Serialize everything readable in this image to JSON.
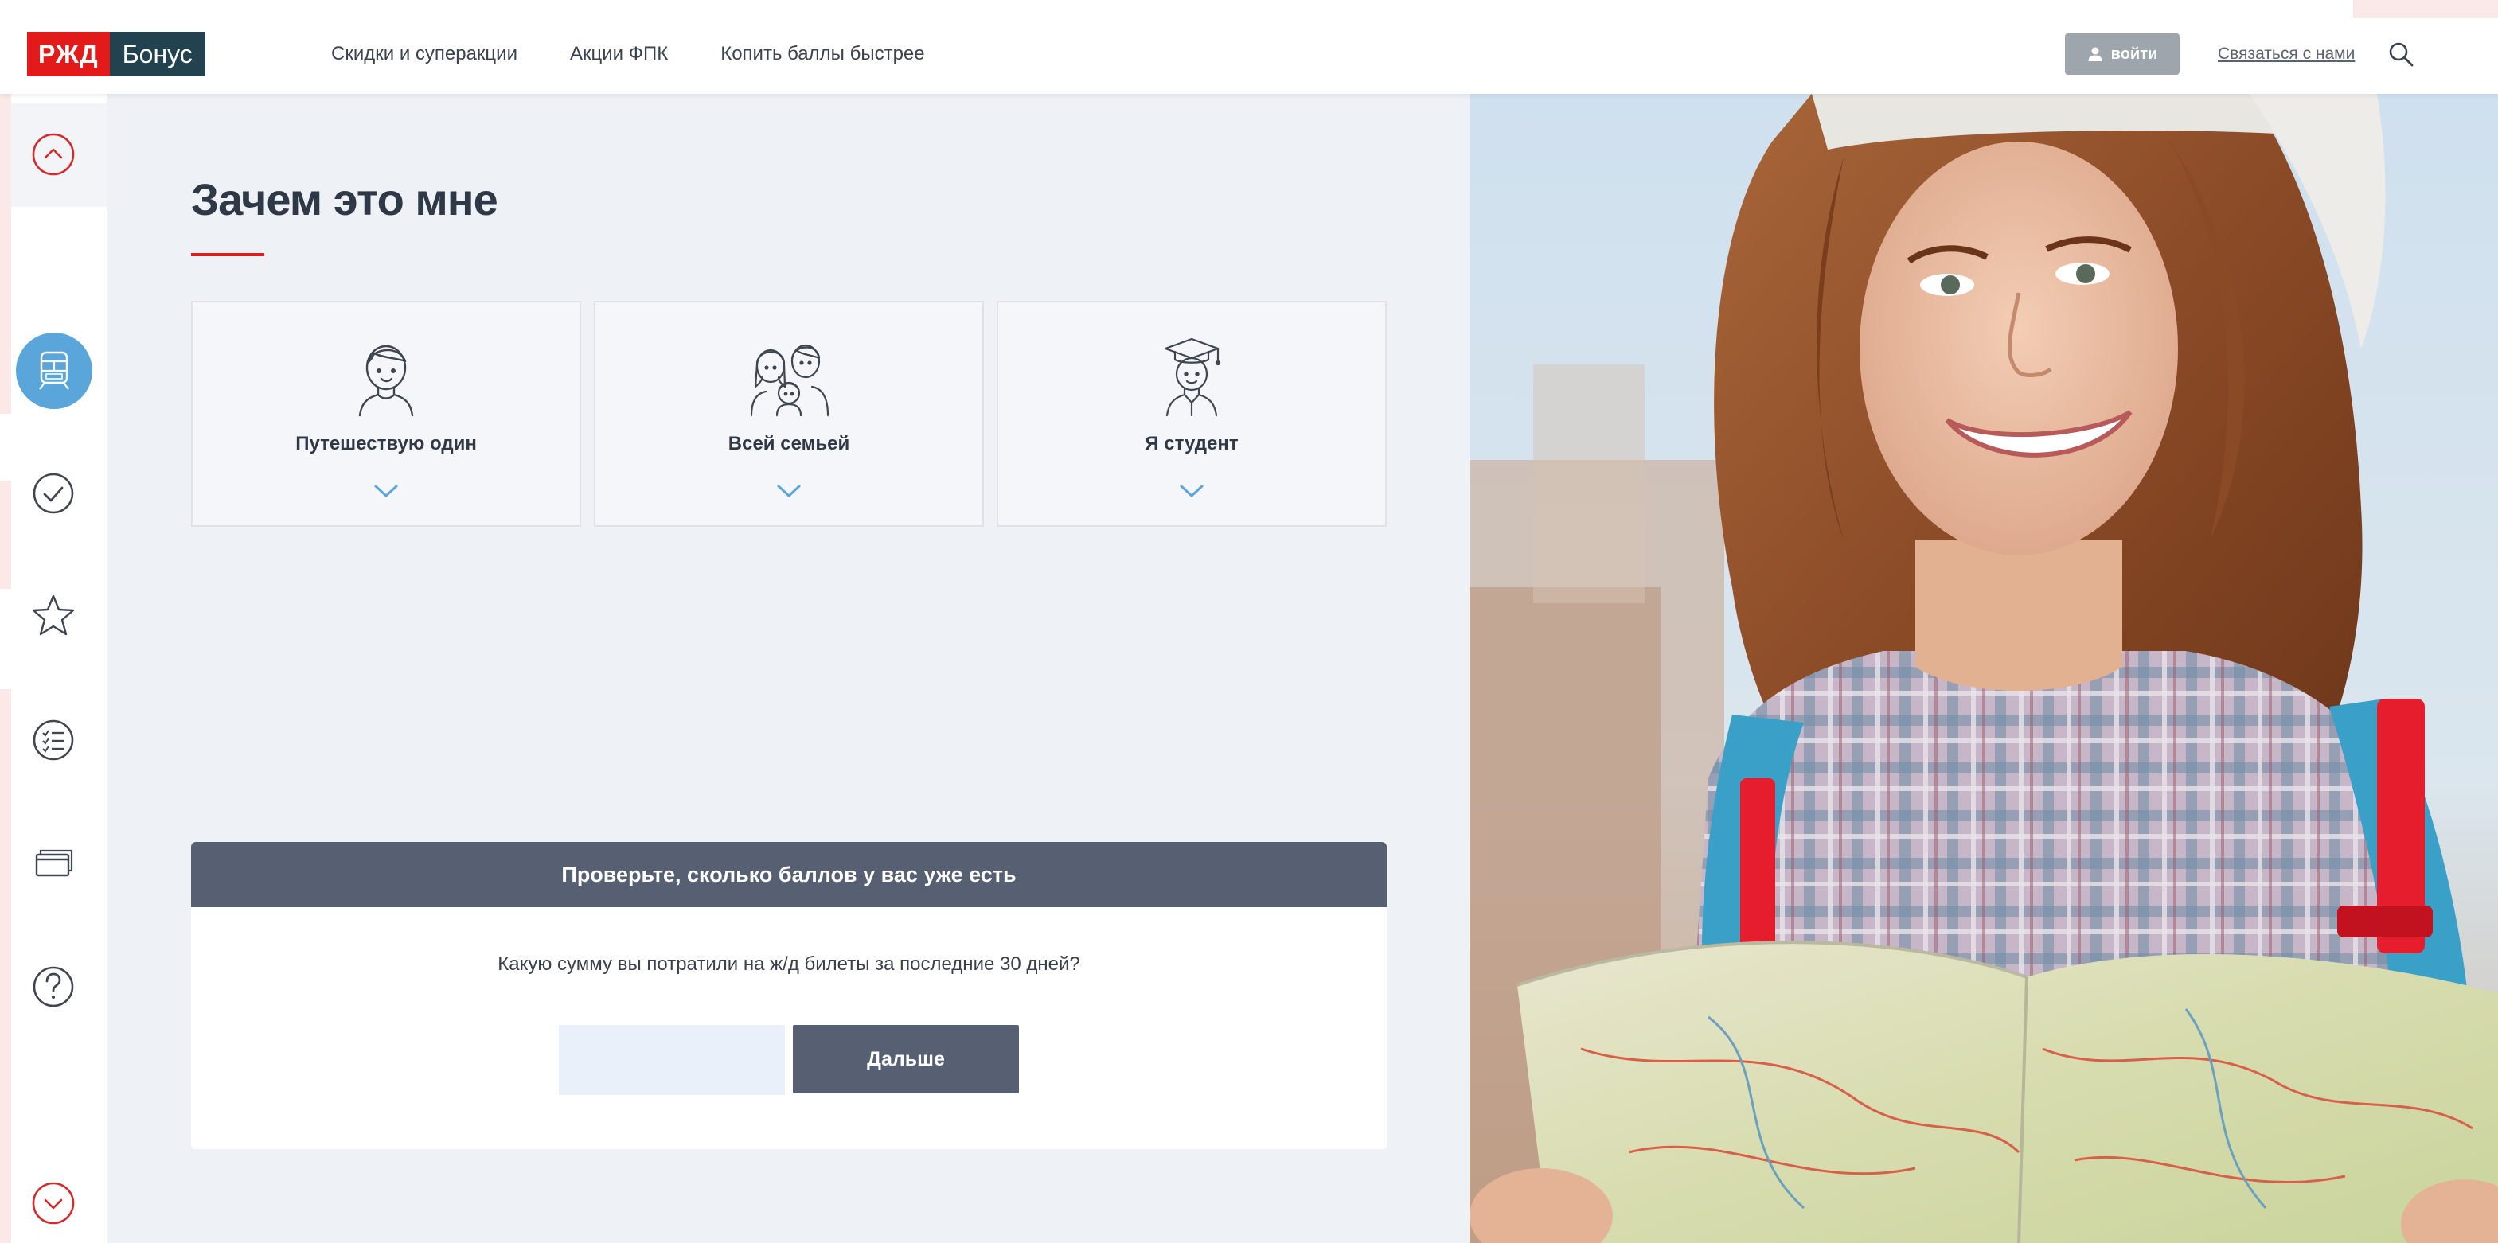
{
  "colors": {
    "brand_red": "#e21a1a",
    "brand_dark": "#23424f",
    "accent_blue": "#5aa6da",
    "panel_slate": "#566072"
  },
  "header": {
    "logo": {
      "part1": "РЖД",
      "part2": "Бонус"
    },
    "nav": [
      {
        "label": "Скидки и суперакции"
      },
      {
        "label": "Акции ФПК"
      },
      {
        "label": "Копить баллы быстрее"
      }
    ],
    "login_label": "войти",
    "contact_label": "Связаться с нами",
    "icons": {
      "login": "user-icon",
      "search": "search-icon"
    }
  },
  "sidebar": {
    "icons": [
      "chevron-up-icon",
      "train-icon",
      "check-circle-icon",
      "star-icon",
      "checklist-icon",
      "cards-icon",
      "help-icon",
      "chevron-down-icon"
    ],
    "active": "train-icon"
  },
  "main": {
    "title": "Зачем это мне",
    "cards": [
      {
        "label": "Путешествую один",
        "icon": "person-icon"
      },
      {
        "label": "Всей семьей",
        "icon": "family-icon"
      },
      {
        "label": "Я студент",
        "icon": "student-icon"
      }
    ]
  },
  "points_panel": {
    "header": "Проверьте, сколько баллов у вас уже есть",
    "question": "Какую сумму вы потратили на ж/д билеты за последние 30 дней?",
    "input_value": "",
    "input_placeholder": "",
    "button_label": "Дальше"
  },
  "hero": {
    "image": "traveler-photo"
  }
}
